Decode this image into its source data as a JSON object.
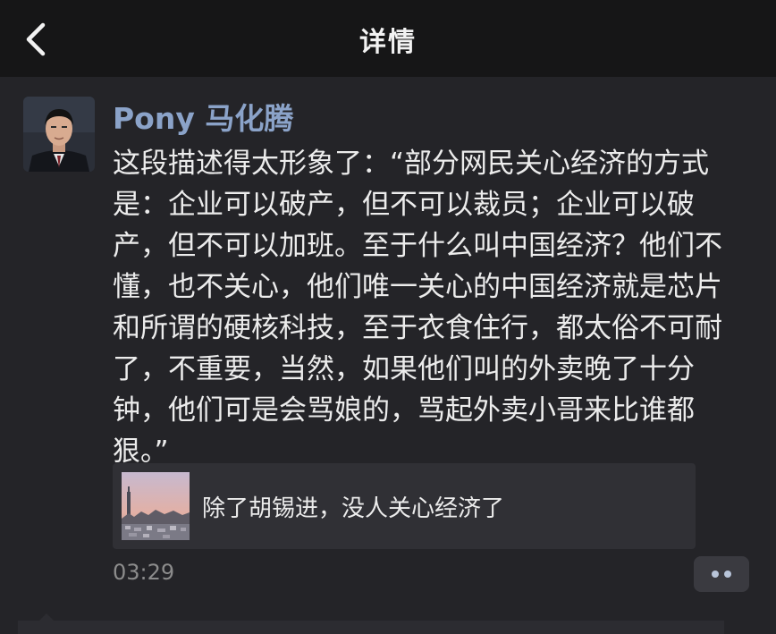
{
  "navbar": {
    "title": "详情",
    "back_icon": "chevron-left-icon"
  },
  "post": {
    "author": "Pony 马化腾",
    "text": "这段描述得太形象了：“部分网民关心经济的方式是：企业可以破产，但不可以裁员；企业可以破产，但不可以加班。至于什么叫中国经济？他们不懂，也不关心，他们唯一关心的中国经济就是芯片和所谓的硬核科技，至于衣食住行，都太俗不可耐了，不重要，当然，如果他们叫的外卖晚了十分钟，他们可是会骂娘的，骂起外卖小哥来比谁都狠。”",
    "link_card": {
      "title": "除了胡锡进，没人关心经济了"
    },
    "timestamp": "03:29",
    "more_icon": "more-dots-icon"
  },
  "colors": {
    "navbar_bg": "#161617",
    "page_bg": "#242428",
    "author_name": "#8ba3c9",
    "body_text": "#ececec",
    "timestamp": "#8c8c8c",
    "card_bg": "#303035"
  }
}
